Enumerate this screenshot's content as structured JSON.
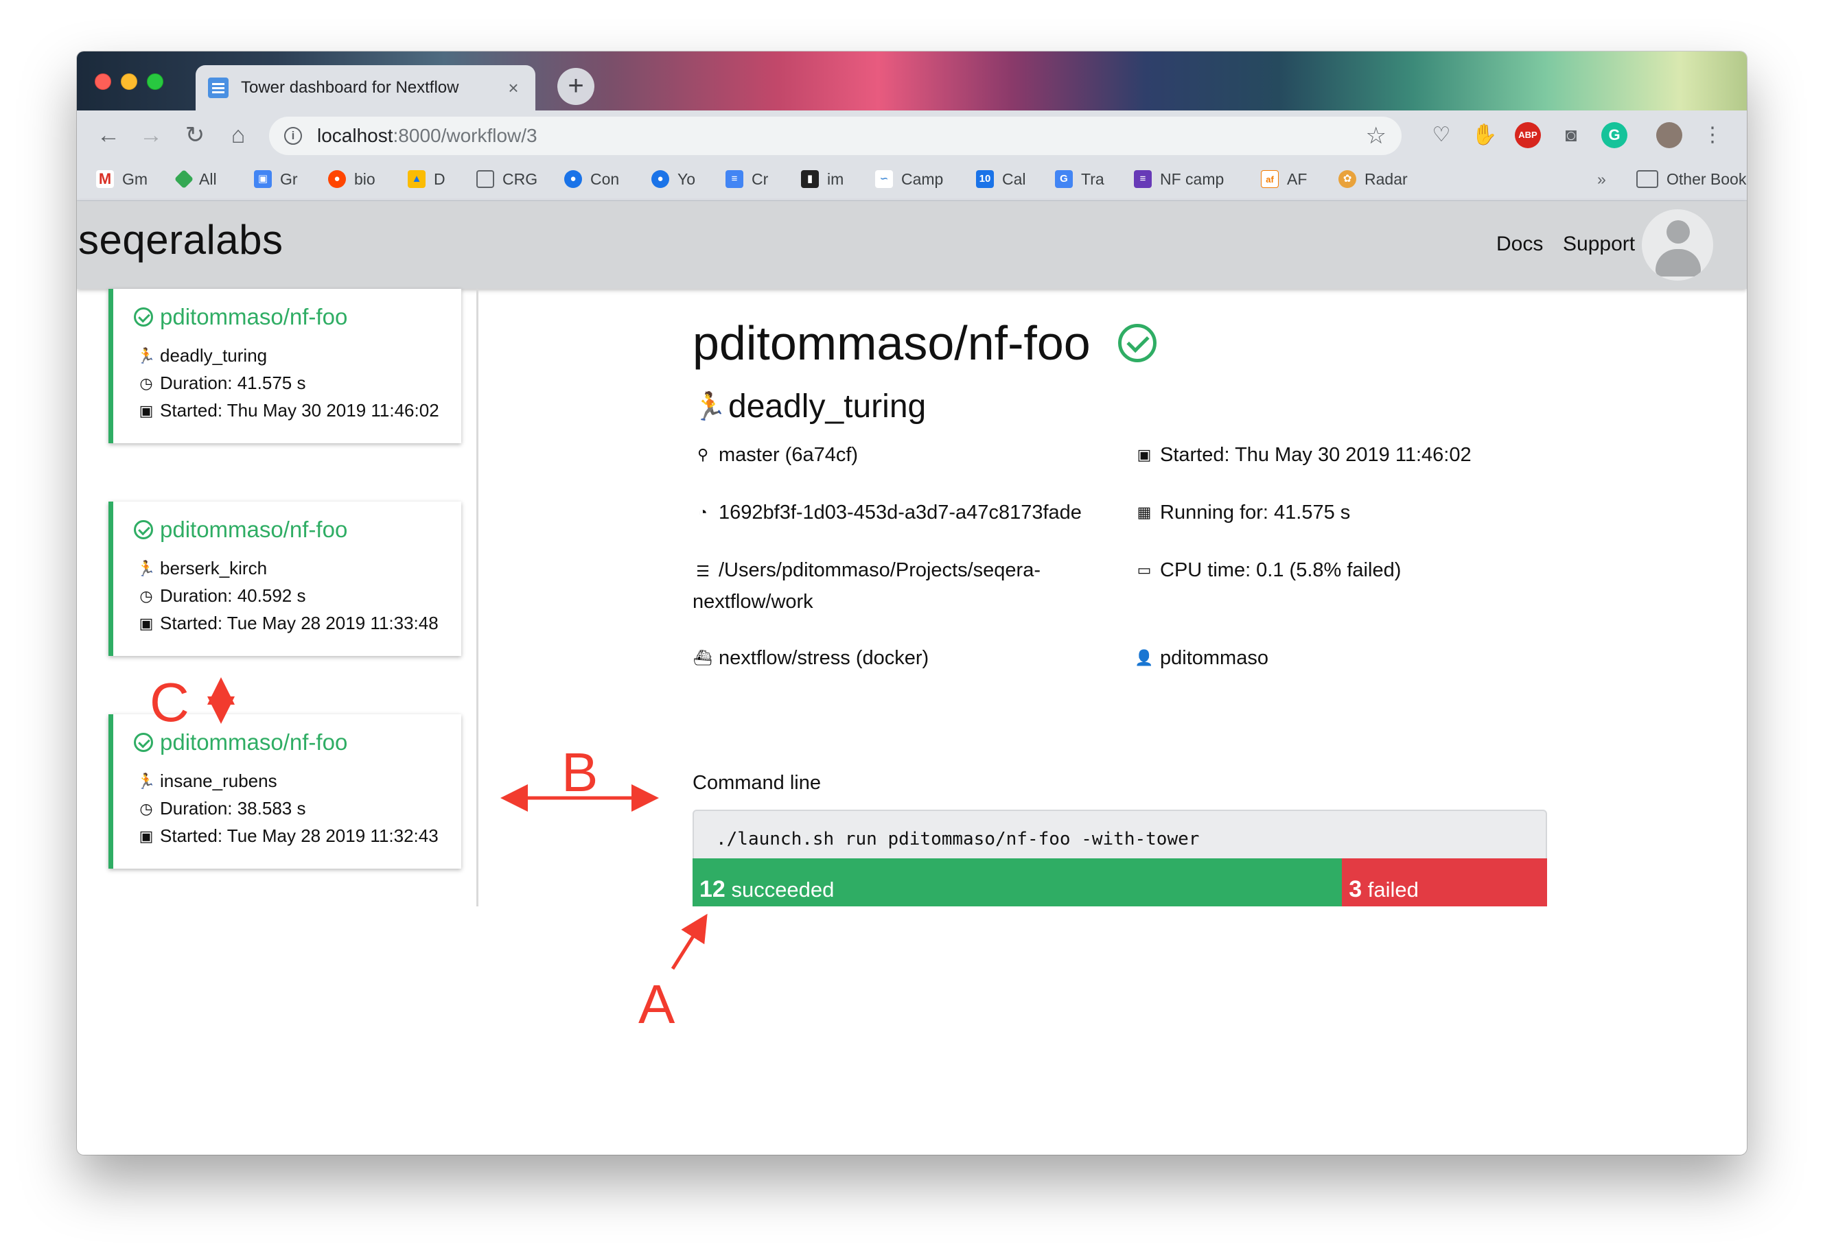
{
  "browser": {
    "tab_title": "Tower dashboard for Nextflow",
    "tab_close": "×",
    "new_tab": "+",
    "url_host": "localhost",
    "url_rest": ":8000/workflow/3",
    "bookmarks": [
      "Gm",
      "All",
      "Gr",
      "bio",
      "D",
      "CRG",
      "Con",
      "Yo",
      "Cr",
      "im",
      "Camp",
      "Cal",
      "Tra",
      "NF camp",
      "AF",
      "Radar"
    ],
    "bookmarks_overflow": "»",
    "other_bookmarks": "Other Bookmarks"
  },
  "app": {
    "brand": "seqeralabs",
    "nav": [
      "Docs",
      "Support"
    ]
  },
  "sidebar": {
    "cards": [
      {
        "title": "pditommaso/nf-foo",
        "run": "deadly_turing",
        "duration": "Duration: 41.575 s",
        "started": "Started: Thu May 30 2019 11:46:02"
      },
      {
        "title": "pditommaso/nf-foo",
        "run": "berserk_kirch",
        "duration": "Duration: 40.592 s",
        "started": "Started: Tue May 28 2019 11:33:48"
      },
      {
        "title": "pditommaso/nf-foo",
        "run": "insane_rubens",
        "duration": "Duration: 38.583 s",
        "started": "Started: Tue May 28 2019 11:32:43"
      }
    ]
  },
  "main": {
    "title": "pditommaso/nf-foo",
    "run_name": "deadly_turing",
    "revision": "master (6a74cf)",
    "started": "Started: Thu May 30 2019 11:46:02",
    "session_id": "1692bf3f-1d03-453d-a3d7-a47c8173fade",
    "running_for": "Running for: 41.575 s",
    "work_dir": "/Users/pditommaso/Projects/seqera-nextflow/work",
    "cpu_time": "CPU time: 0.1 (5.8% failed)",
    "container": "nextflow/stress (docker)",
    "user": "pditommaso",
    "command_label": "Command line",
    "command": "./launch.sh run pditommaso/nf-foo -with-tower",
    "progress": {
      "succeeded_count": "12",
      "succeeded_label": "succeeded",
      "failed_count": "3",
      "failed_label": "failed",
      "succeeded_fraction": 0.76,
      "succeeded_color": "#2fad64",
      "failed_color": "#e33b43"
    }
  },
  "annotations": {
    "a": "A",
    "b": "B",
    "c": "C",
    "color": "#f23b2e"
  }
}
